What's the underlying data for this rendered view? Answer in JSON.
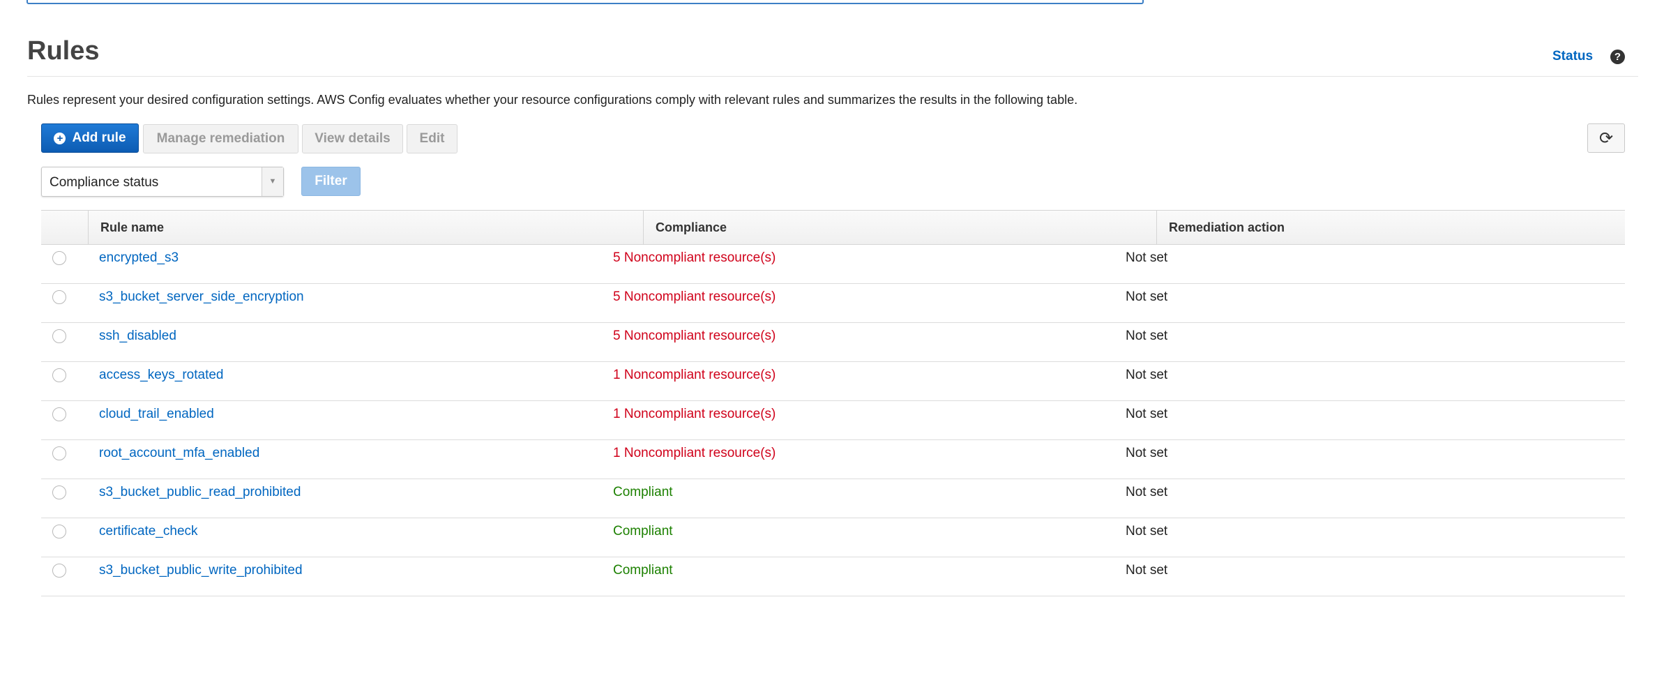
{
  "page": {
    "title": "Rules",
    "status_link": "Status",
    "help_glyph": "?",
    "description": "Rules represent your desired configuration settings. AWS Config evaluates whether your resource configurations comply with relevant rules and summarizes the results in the following table."
  },
  "toolbar": {
    "add_rule": "Add rule",
    "manage_remediation": "Manage remediation",
    "view_details": "View details",
    "edit": "Edit",
    "refresh_glyph": "⟳"
  },
  "filter": {
    "select_value": "Compliance status",
    "filter_button": "Filter"
  },
  "table": {
    "headers": {
      "rule_name": "Rule name",
      "compliance": "Compliance",
      "remediation": "Remediation action"
    },
    "rows": [
      {
        "name": "encrypted_s3",
        "compliance": "5 Noncompliant resource(s)",
        "remediation": "Not set"
      },
      {
        "name": "s3_bucket_server_side_encryption",
        "compliance": "5 Noncompliant resource(s)",
        "remediation": "Not set"
      },
      {
        "name": "ssh_disabled",
        "compliance": "5 Noncompliant resource(s)",
        "remediation": "Not set"
      },
      {
        "name": "access_keys_rotated",
        "compliance": "1 Noncompliant resource(s)",
        "remediation": "Not set"
      },
      {
        "name": "cloud_trail_enabled",
        "compliance": "1 Noncompliant resource(s)",
        "remediation": "Not set"
      },
      {
        "name": "root_account_mfa_enabled",
        "compliance": "1 Noncompliant resource(s)",
        "remediation": "Not set"
      },
      {
        "name": "s3_bucket_public_read_prohibited",
        "compliance": "Compliant",
        "remediation": "Not set"
      },
      {
        "name": "certificate_check",
        "compliance": "Compliant",
        "remediation": "Not set"
      },
      {
        "name": "s3_bucket_public_write_prohibited",
        "compliance": "Compliant",
        "remediation": "Not set"
      }
    ]
  },
  "colors": {
    "link": "#0066c0",
    "noncompliant": "#d0021b",
    "compliant": "#1d8102",
    "primary_button": "#0d5cb3"
  }
}
